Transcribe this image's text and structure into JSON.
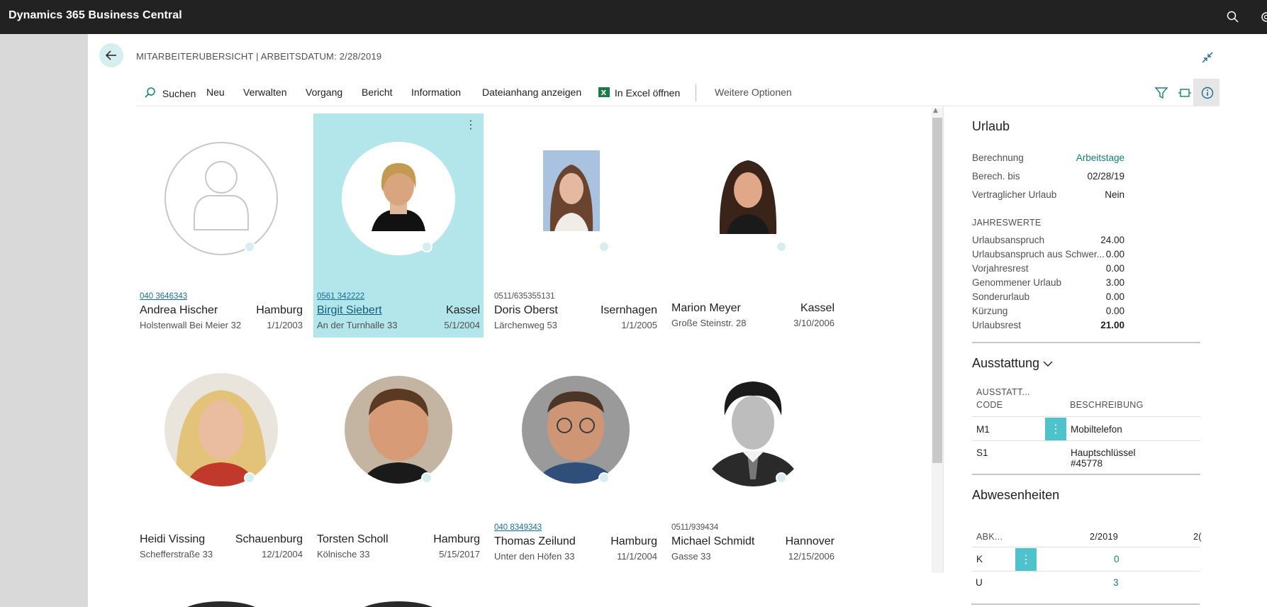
{
  "app": {
    "title": "Dynamics 365 Business Central"
  },
  "page": {
    "title": "MITARBEITERUBERSICHT | ARBEITSDATUM: 2/28/2019"
  },
  "actions": {
    "search": "Suchen",
    "new": "Neu",
    "manage": "Verwalten",
    "process": "Vorgang",
    "report": "Bericht",
    "information": "Information",
    "attachments": "Dateianhang anzeigen",
    "excel": "In Excel öffnen",
    "more": "Weitere Optionen"
  },
  "employees": [
    {
      "phone": "040 3646343",
      "phone_link": true,
      "name": "Andrea Hischer",
      "city": "Hamburg",
      "address": "Holstenwall Bei Meier 32",
      "date": "1/1/2003",
      "photo": "placeholder"
    },
    {
      "phone": "0561 342222",
      "phone_link": true,
      "name": "Birgit Siebert",
      "city": "Kassel",
      "address": "An der Turnhalle 33",
      "date": "5/1/2004",
      "selected": true,
      "photo": "portrait"
    },
    {
      "phone": "0511/635355131",
      "phone_link": false,
      "name": "Doris Oberst",
      "city": "Isernhagen",
      "address": "Lärchenweg 53",
      "date": "1/1/2005",
      "photo": "portrait"
    },
    {
      "phone": "",
      "phone_link": false,
      "name": "Marion Meyer",
      "city": "Kassel",
      "address": "Große Steinstr. 28",
      "date": "3/10/2006",
      "photo": "portrait"
    },
    {
      "phone": "",
      "phone_link": false,
      "name": "Heidi Vissing",
      "city": "Schauenburg",
      "address": "Schefferstraße 33",
      "date": "12/1/2004",
      "photo": "portrait"
    },
    {
      "phone": "",
      "phone_link": false,
      "name": "Torsten Scholl",
      "city": "Hamburg",
      "address": "Kölnische 33",
      "date": "5/15/2017",
      "photo": "portrait"
    },
    {
      "phone": "040 8349343",
      "phone_link": true,
      "name": "Thomas Zeilund",
      "city": "Hamburg",
      "address": "Unter den Höfen 33",
      "date": "11/1/2004",
      "photo": "portrait"
    },
    {
      "phone": "0511/939434",
      "phone_link": false,
      "name": "Michael Schmidt",
      "city": "Hannover",
      "address": "Gasse 33",
      "date": "12/15/2006",
      "photo": "portrait"
    }
  ],
  "factbox": {
    "vacation": {
      "title": "Urlaub",
      "rows": [
        {
          "label": "Berechnung",
          "value": "Arbeitstage"
        },
        {
          "label": "Berech. bis",
          "value": "02/28/19"
        },
        {
          "label": "Vertraglicher Urlaub",
          "value": "Nein"
        }
      ],
      "annual_heading": "JAHRESWERTE",
      "annual": [
        {
          "label": "Urlaubsanspruch",
          "value": "24.00"
        },
        {
          "label": "Urlaubsanspruch aus Schwer...",
          "value": "0.00"
        },
        {
          "label": "Vorjahresrest",
          "value": "0.00"
        },
        {
          "label": "Genommener Urlaub",
          "value": "3.00"
        },
        {
          "label": "Sonderurlaub",
          "value": "0.00"
        },
        {
          "label": "Kürzung",
          "value": "0.00"
        },
        {
          "label": "Urlaubsrest",
          "value": "21.00"
        }
      ]
    },
    "equipment": {
      "title": "Ausstattung",
      "col_code_line1": "AUSSTATT...",
      "col_code_line2": "CODE",
      "col_desc": "BESCHREIBUNG",
      "rows": [
        {
          "code": "M1",
          "desc": "Mobiltelefon"
        },
        {
          "code": "S1",
          "desc": "Hauptschlüssel #45778"
        }
      ]
    },
    "absences": {
      "title": "Abwesenheiten",
      "col_abbr": "ABK...",
      "col_month": "2/2019",
      "col_month2": "2(",
      "rows": [
        {
          "abbr": "K",
          "value": "0"
        },
        {
          "abbr": "U",
          "value": "3"
        }
      ]
    }
  }
}
